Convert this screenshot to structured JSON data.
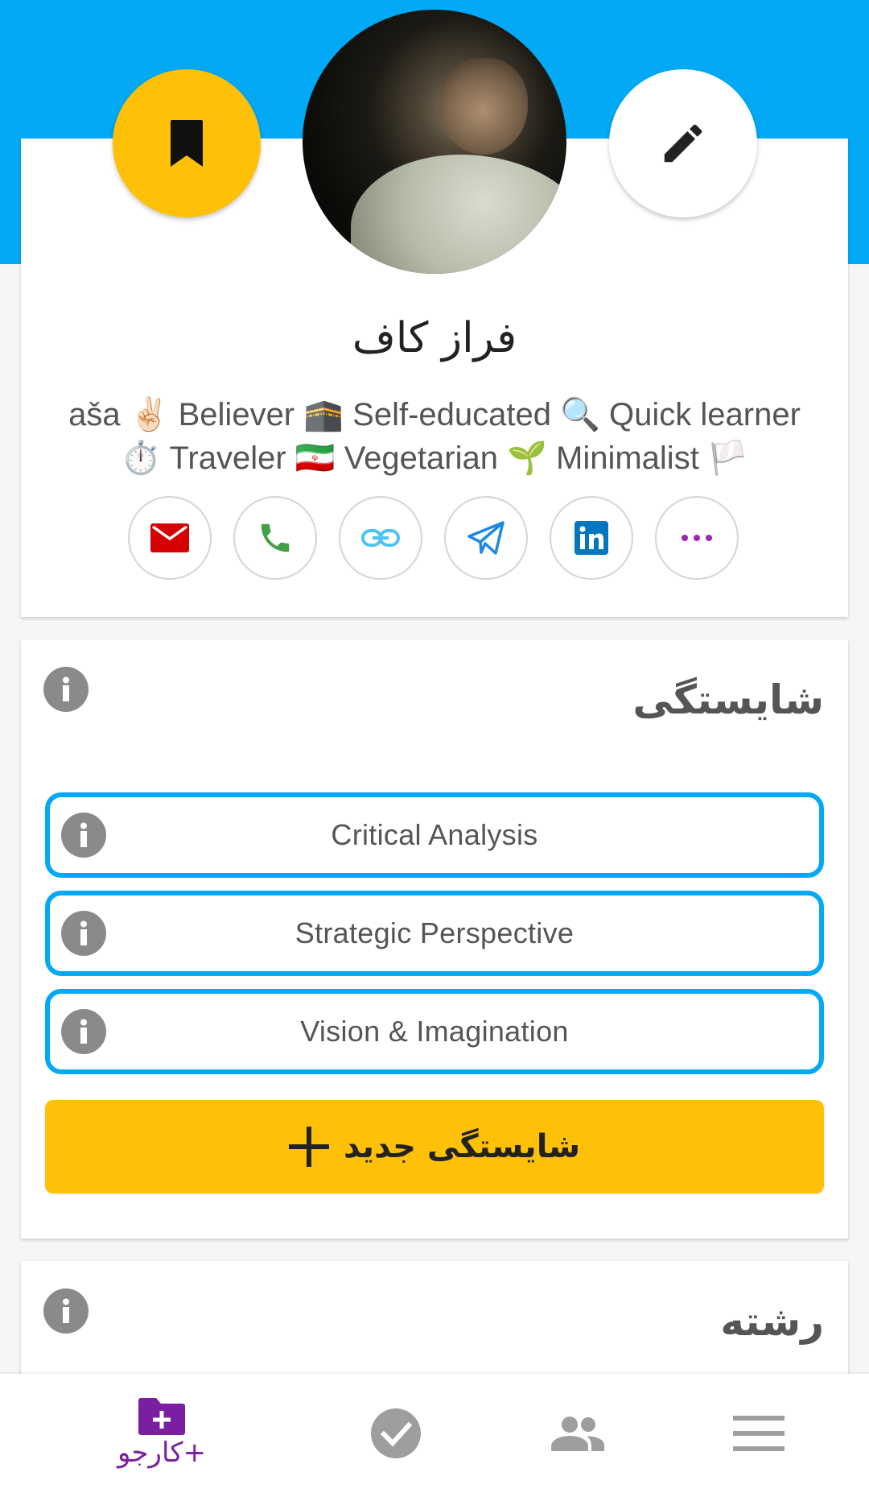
{
  "colors": {
    "accent_blue": "#03a9f4",
    "accent_yellow": "#fec107",
    "brand_purple": "#7b1fa2",
    "icon_gray": "#8a8a8a"
  },
  "header": {
    "bookmark_icon": "bookmark-icon",
    "edit_icon": "pencil-icon"
  },
  "profile": {
    "name": "فراز کاف",
    "bio": "aša ✌🏻 Believer 🕋 Self-educated 🔍 Quick learner ⏱️ Traveler 🇮🇷 Vegetarian 🌱 Minimalist 🏳️"
  },
  "contacts": [
    {
      "name": "email",
      "icon": "email-icon",
      "color": "#d50000"
    },
    {
      "name": "phone",
      "icon": "phone-icon",
      "color": "#43a047"
    },
    {
      "name": "link",
      "icon": "link-icon",
      "color": "#4fc3f7"
    },
    {
      "name": "telegram",
      "icon": "telegram-icon",
      "color": "#1e88e5"
    },
    {
      "name": "linkedin",
      "icon": "linkedin-icon",
      "color": "#0277bd"
    },
    {
      "name": "more",
      "icon": "more-horizontal-icon",
      "color": "#9c27b0"
    }
  ],
  "competencies": {
    "title": "شایستگی",
    "items": [
      "Critical Analysis",
      "Strategic Perspective",
      "Vision & Imagination"
    ],
    "add_label": "شایستگی جدید"
  },
  "field_section": {
    "title": "رشته"
  },
  "bottom_nav": {
    "items": [
      {
        "label": "کارجو+",
        "icon": "folder-add-icon",
        "active": true
      },
      {
        "label": "",
        "icon": "check-circle-icon",
        "active": false
      },
      {
        "label": "",
        "icon": "people-icon",
        "active": false
      },
      {
        "label": "",
        "icon": "menu-icon",
        "active": false
      }
    ]
  }
}
